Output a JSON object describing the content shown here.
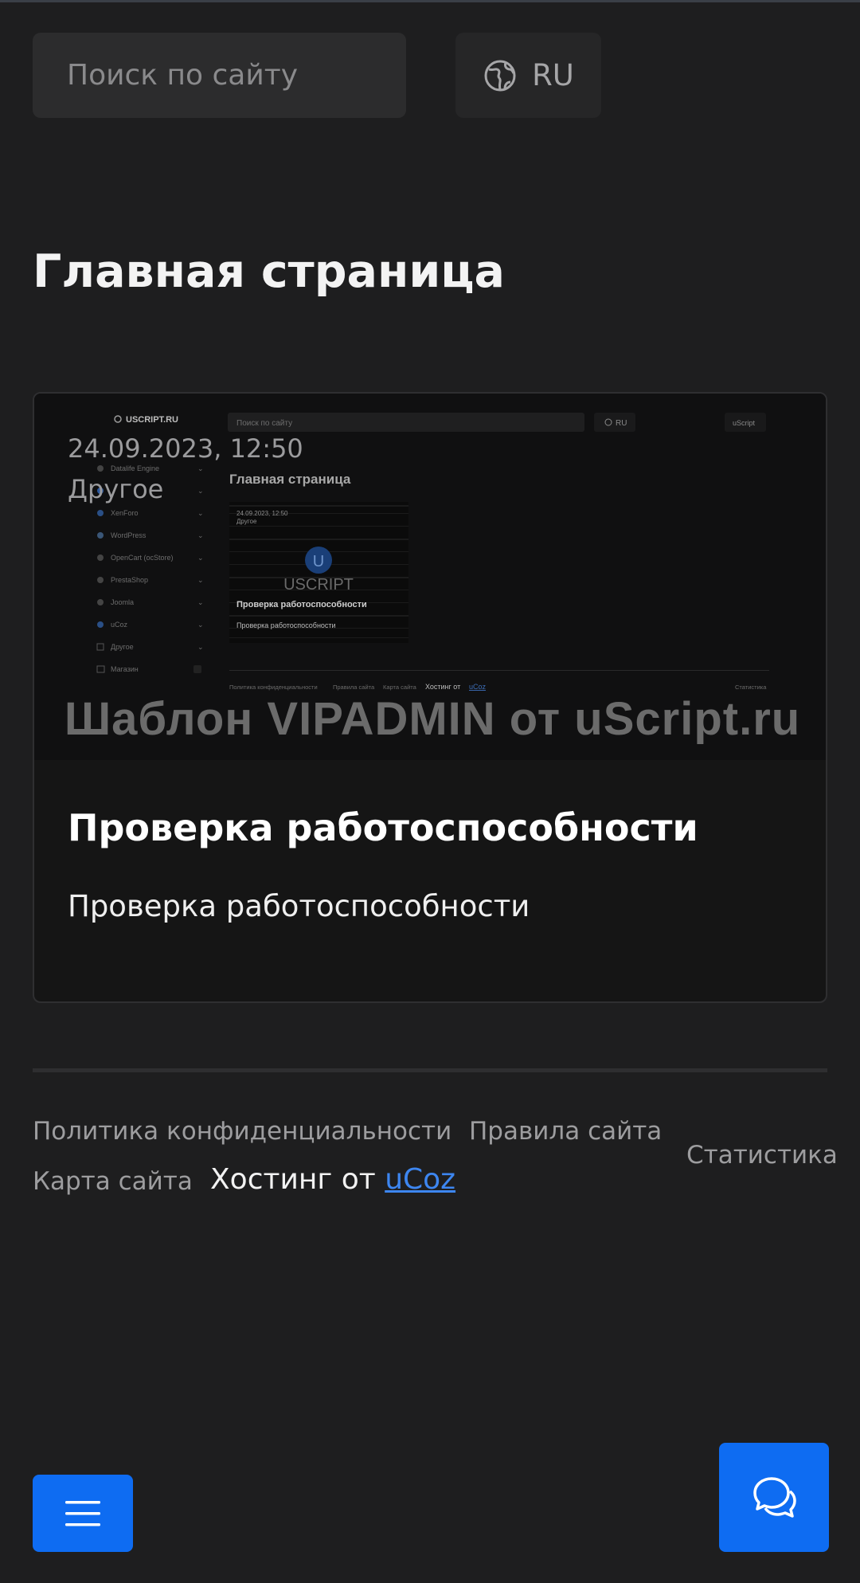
{
  "search": {
    "placeholder": "Поиск по сайту"
  },
  "language": {
    "label": "RU"
  },
  "page": {
    "title": "Главная страница"
  },
  "post": {
    "date": "24.09.2023, 12:50",
    "category": "Другое",
    "watermark": "Шаблон VIPADMIN от uScript.ru",
    "title": "Проверка работоспособности",
    "description": "Проверка работоспособности",
    "preview": {
      "logo": "USCRIPT.RU",
      "search_placeholder": "Поиск по сайту",
      "lang": "RU",
      "user": "uScript",
      "page_title": "Главная страница",
      "menu": [
        "Datalife Engine",
        "",
        "XenForo",
        "WordPress",
        "OpenCart (ocStore)",
        "PrestaShop",
        "Joomla",
        "uCoz",
        "Другое",
        "Магазин"
      ],
      "card_date": "24.09.2023, 12:50",
      "card_category": "Другое",
      "card_brand_letter": "U",
      "card_brand": "USCRIPT",
      "card_title": "Проверка работоспособности",
      "card_desc": "Проверка работоспособности",
      "footer": [
        "Политика конфиденциальности",
        "Правила сайта",
        "Карта сайта"
      ],
      "footer_hosting": "Хостинг от",
      "footer_hosting_link": "uCoz",
      "footer_stats": "Статистика"
    }
  },
  "footer": {
    "privacy": "Политика конфиденциальности",
    "rules": "Правила сайта",
    "sitemap": "Карта сайта",
    "hosting_prefix": "Хостинг от ",
    "hosting_link": "uCoz",
    "stats": "Статистика"
  },
  "colors": {
    "accent": "#0e6cf2",
    "background": "#1e1e1f",
    "link": "#3d86f0"
  },
  "icons": {
    "language": "globe-icon",
    "menu": "hamburger-menu-icon",
    "chat": "chat-bubbles-icon"
  }
}
